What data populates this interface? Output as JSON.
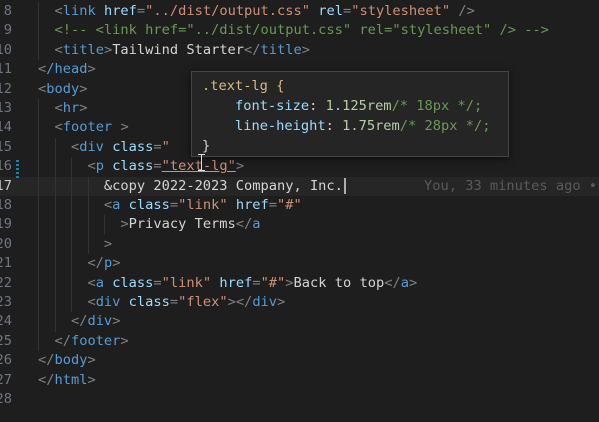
{
  "lines": [
    {
      "n": "8",
      "current": false,
      "tokens": [
        [
          "p",
          "  <"
        ],
        [
          "tg",
          "link"
        ],
        [
          "t",
          " "
        ],
        [
          "a",
          "href"
        ],
        [
          "p",
          "="
        ],
        [
          "s",
          "\"../dist/output.css\""
        ],
        [
          "t",
          " "
        ],
        [
          "a",
          "rel"
        ],
        [
          "p",
          "="
        ],
        [
          "s",
          "\"stylesheet\""
        ],
        [
          "t",
          " "
        ],
        [
          "p",
          "/>"
        ]
      ]
    },
    {
      "n": "9",
      "current": false,
      "tokens": [
        [
          "c",
          "  <!-- <link href=\"../dist/output.css\" rel=\"stylesheet\" /> -->"
        ]
      ]
    },
    {
      "n": "10",
      "current": false,
      "tokens": [
        [
          "p",
          "  <"
        ],
        [
          "tg",
          "title"
        ],
        [
          "p",
          ">"
        ],
        [
          "t",
          "Tailwind Starter"
        ],
        [
          "p",
          "</"
        ],
        [
          "tg",
          "title"
        ],
        [
          "p",
          ">"
        ]
      ]
    },
    {
      "n": "11",
      "current": false,
      "tokens": [
        [
          "p",
          "<"
        ],
        [
          "tg",
          "/head"
        ],
        [
          "p",
          ">"
        ]
      ]
    },
    {
      "n": "12",
      "current": false,
      "tokens": [
        [
          "p",
          "<"
        ],
        [
          "tg",
          "body"
        ],
        [
          "p",
          ">"
        ]
      ]
    },
    {
      "n": "13",
      "current": false,
      "tokens": [
        [
          "p",
          "  <"
        ],
        [
          "tg",
          "hr"
        ],
        [
          "p",
          ">"
        ]
      ]
    },
    {
      "n": "14",
      "current": false,
      "tokens": [
        [
          "p",
          "  <"
        ],
        [
          "tg",
          "footer"
        ],
        [
          "t",
          " "
        ],
        [
          "p",
          ">"
        ]
      ]
    },
    {
      "n": "15",
      "current": false,
      "tokens": [
        [
          "p",
          "    <"
        ],
        [
          "tg",
          "div"
        ],
        [
          "t",
          " "
        ],
        [
          "a",
          "class"
        ],
        [
          "p",
          "="
        ],
        [
          "s",
          "\""
        ]
      ]
    },
    {
      "n": "16",
      "current": false,
      "tokens": [
        [
          "p",
          "      <"
        ],
        [
          "tg",
          "p"
        ],
        [
          "t",
          " "
        ],
        [
          "a",
          "class"
        ],
        [
          "p",
          "="
        ],
        [
          "s",
          "\"text-lg\""
        ],
        [
          "p",
          ">"
        ]
      ]
    },
    {
      "n": "17",
      "current": true,
      "tokens": [
        [
          "t",
          "        &copy 2022-2023 Company, Inc."
        ]
      ]
    },
    {
      "n": "18",
      "current": false,
      "tokens": [
        [
          "p",
          "        <"
        ],
        [
          "tg",
          "a"
        ],
        [
          "t",
          " "
        ],
        [
          "a",
          "class"
        ],
        [
          "p",
          "="
        ],
        [
          "s",
          "\"link\""
        ],
        [
          "t",
          " "
        ],
        [
          "a",
          "href"
        ],
        [
          "p",
          "="
        ],
        [
          "s",
          "\"#\""
        ]
      ]
    },
    {
      "n": "19",
      "current": false,
      "tokens": [
        [
          "p",
          "          >"
        ],
        [
          "t",
          "Privacy Terms"
        ],
        [
          "p",
          "</"
        ],
        [
          "tg",
          "a"
        ]
      ]
    },
    {
      "n": "20",
      "current": false,
      "tokens": [
        [
          "p",
          "        >"
        ]
      ]
    },
    {
      "n": "21",
      "current": false,
      "tokens": [
        [
          "p",
          "      </"
        ],
        [
          "tg",
          "p"
        ],
        [
          "p",
          ">"
        ]
      ]
    },
    {
      "n": "22",
      "current": false,
      "tokens": [
        [
          "p",
          "      <"
        ],
        [
          "tg",
          "a"
        ],
        [
          "t",
          " "
        ],
        [
          "a",
          "class"
        ],
        [
          "p",
          "="
        ],
        [
          "s",
          "\"link\""
        ],
        [
          "t",
          " "
        ],
        [
          "a",
          "href"
        ],
        [
          "p",
          "="
        ],
        [
          "s",
          "\"#\""
        ],
        [
          "p",
          ">"
        ],
        [
          "t",
          "Back to top"
        ],
        [
          "p",
          "</"
        ],
        [
          "tg",
          "a"
        ],
        [
          "p",
          ">"
        ]
      ]
    },
    {
      "n": "23",
      "current": false,
      "tokens": [
        [
          "p",
          "      <"
        ],
        [
          "tg",
          "div"
        ],
        [
          "t",
          " "
        ],
        [
          "a",
          "class"
        ],
        [
          "p",
          "="
        ],
        [
          "s",
          "\"flex\""
        ],
        [
          "p",
          "></"
        ],
        [
          "tg",
          "div"
        ],
        [
          "p",
          ">"
        ]
      ]
    },
    {
      "n": "24",
      "current": false,
      "tokens": [
        [
          "p",
          "    </"
        ],
        [
          "tg",
          "div"
        ],
        [
          "p",
          ">"
        ]
      ]
    },
    {
      "n": "25",
      "current": false,
      "tokens": [
        [
          "p",
          "  </"
        ],
        [
          "tg",
          "footer"
        ],
        [
          "p",
          ">"
        ]
      ]
    },
    {
      "n": "26",
      "current": false,
      "tokens": [
        [
          "p",
          "</"
        ],
        [
          "tg",
          "body"
        ],
        [
          "p",
          ">"
        ]
      ]
    },
    {
      "n": "27",
      "current": false,
      "tokens": [
        [
          "p",
          "</"
        ],
        [
          "tg",
          "html"
        ],
        [
          "p",
          ">"
        ]
      ]
    },
    {
      "n": "28",
      "current": false,
      "tokens": []
    }
  ],
  "blame": "You, 33 minutes ago •",
  "hover": {
    "selector": ".text-lg {",
    "prop1": "font-size",
    "val1": "1.125rem",
    "com1": "/* 18px */;",
    "prop2": "line-height",
    "val2": "1.75rem",
    "com2": "/* 28px */;",
    "close": "}"
  }
}
